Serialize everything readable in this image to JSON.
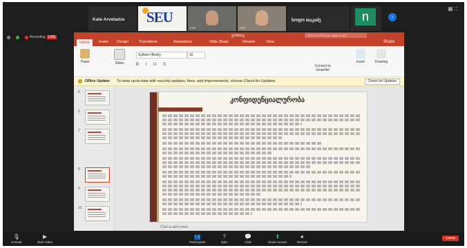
{
  "zoom": {
    "participants": [
      {
        "name": "Kate Arveladze"
      },
      {
        "logo": "SEU"
      },
      {
        "label": "user"
      },
      {
        "label": "user"
      },
      {
        "name": "სოფო თაკაძე"
      },
      {
        "initial": "n"
      }
    ],
    "recording": {
      "text": "Recording",
      "live": "LIVE"
    },
    "toolbar": [
      {
        "label": "Unmute",
        "icon": "microphone-icon"
      },
      {
        "label": "Start Video",
        "icon": "video-icon"
      },
      {
        "label": "Participants",
        "icon": "participants-icon"
      },
      {
        "label": "Q&A",
        "icon": "qa-icon"
      },
      {
        "label": "Chat",
        "icon": "chat-icon"
      },
      {
        "label": "Share Screen",
        "icon": "share-screen-icon"
      },
      {
        "label": "Record",
        "icon": "record-icon"
      }
    ],
    "leave": "Leave"
  },
  "ppt": {
    "filename": "ვოთიკ",
    "search_placeholder": "Tell me what you want to do",
    "tabs": [
      "Home",
      "Insert",
      "Design",
      "Transitions",
      "Animations",
      "Slide Show",
      "Review",
      "View"
    ],
    "share": "Share",
    "ribbon": {
      "paste": "Paste",
      "slides": "Slides",
      "font": "Sylfaen (Body)",
      "size": "16",
      "convert": "Convert to SmartArt",
      "insert": "Insert",
      "drawing": "Drawing"
    },
    "update_bar": {
      "title": "Office Update",
      "message": "To keep up-to-date with security updates, fixes, and improvements, choose Check for Updates.",
      "button": "Check for Updates"
    },
    "thumbnails": [
      "5",
      "6",
      "7",
      "8",
      "9",
      "10"
    ],
    "selected_thumbnail": "8",
    "slide_title": "კონფიდენციალურობა",
    "notes_placeholder": "Click to add notes",
    "colors": {
      "accent": "#c3432a",
      "slide_bar": "#6e2f24"
    }
  }
}
